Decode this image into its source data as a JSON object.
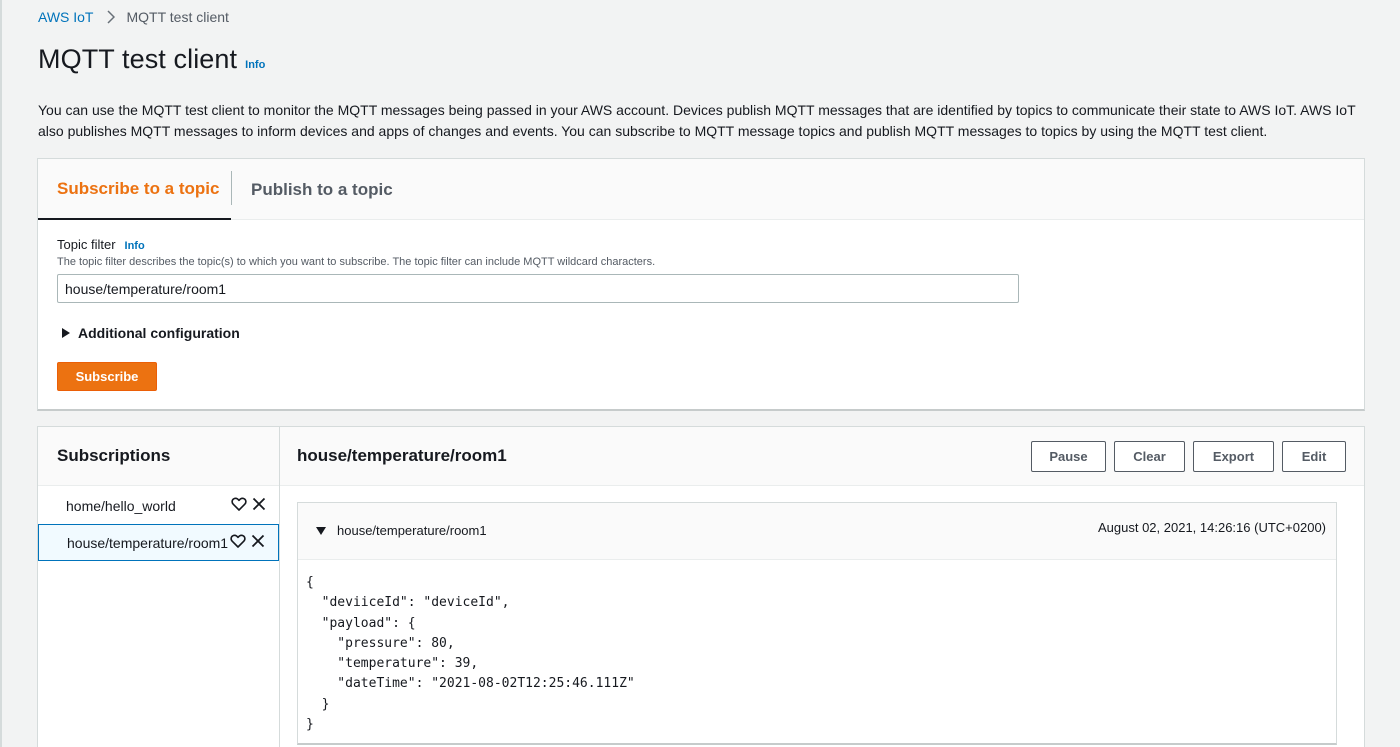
{
  "breadcrumb": {
    "root": "AWS IoT",
    "current": "MQTT test client"
  },
  "page": {
    "title": "MQTT test client",
    "info": "Info",
    "description": "You can use the MQTT test client to monitor the MQTT messages being passed in your AWS account. Devices publish MQTT messages that are identified by topics to communicate their state to AWS IoT. AWS IoT also publishes MQTT messages to inform devices and apps of changes and events. You can subscribe to MQTT message topics and publish MQTT messages to topics by using the MQTT test client."
  },
  "tabs": [
    {
      "label": "Subscribe to a topic",
      "active": true
    },
    {
      "label": "Publish to a topic",
      "active": false
    }
  ],
  "subscribe_form": {
    "label": "Topic filter",
    "info": "Info",
    "description": "The topic filter describes the topic(s) to which you want to subscribe. The topic filter can include MQTT wildcard characters.",
    "value": "house/temperature/room1",
    "additional": "Additional configuration",
    "button": "Subscribe"
  },
  "subscriptions": {
    "title": "Subscriptions",
    "items": [
      {
        "label": "home/hello_world",
        "selected": false
      },
      {
        "label": "house/temperature/room1",
        "selected": true
      }
    ]
  },
  "messages": {
    "topic": "house/temperature/room1",
    "buttons": {
      "pause": "Pause",
      "clear": "Clear",
      "export": "Export",
      "edit": "Edit"
    },
    "items": [
      {
        "topic": "house/temperature/room1",
        "time": "August 02, 2021, 14:26:16 (UTC+0200)",
        "payload": "{\n  \"deviiceId\": \"deviceId\",\n  \"payload\": {\n    \"pressure\": 80,\n    \"temperature\": 39,\n    \"dateTime\": \"2021-08-02T12:25:46.111Z\"\n  }\n}"
      }
    ]
  },
  "colors": {
    "accent": "#ec7211",
    "link": "#0073bb",
    "text": "#16191f",
    "background": "#f2f3f3"
  }
}
